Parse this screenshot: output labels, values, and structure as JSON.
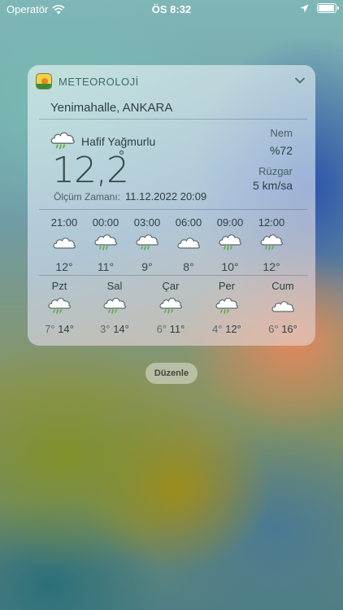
{
  "status_bar": {
    "carrier": "Operatör",
    "time": "ÖS 8:32"
  },
  "widget": {
    "app_name": "METEOROLOJİ",
    "location": "Yenimahalle, ANKARA",
    "current": {
      "condition": "Hafif Yağmurlu",
      "temperature": "12,2",
      "degree_symbol": "°",
      "measure_label": "Ölçüm Zamanı:",
      "measure_time": "11.12.2022 20:09",
      "humidity_label": "Nem",
      "humidity_value": "%72",
      "wind_label": "Rüzgar",
      "wind_value": "5 km/sa"
    },
    "hourly": [
      {
        "time": "21:00",
        "icon": "cloud-icon",
        "temp": "12°"
      },
      {
        "time": "00:00",
        "icon": "rain-cloud-icon",
        "temp": "11°"
      },
      {
        "time": "03:00",
        "icon": "rain-cloud-icon",
        "temp": "9°"
      },
      {
        "time": "06:00",
        "icon": "cloud-icon",
        "temp": "8°"
      },
      {
        "time": "09:00",
        "icon": "rain-cloud-icon",
        "temp": "10°"
      },
      {
        "time": "12:00",
        "icon": "rain-cloud-icon",
        "temp": "12°"
      }
    ],
    "daily": [
      {
        "day": "Pzt",
        "icon": "rain-cloud-icon",
        "low": "7°",
        "high": "14°"
      },
      {
        "day": "Sal",
        "icon": "rain-cloud-icon",
        "low": "3°",
        "high": "14°"
      },
      {
        "day": "Çar",
        "icon": "rain-cloud-icon",
        "low": "6°",
        "high": "11°"
      },
      {
        "day": "Per",
        "icon": "rain-cloud-icon",
        "low": "4°",
        "high": "12°"
      },
      {
        "day": "Cum",
        "icon": "cloud-icon",
        "low": "6°",
        "high": "16°"
      }
    ]
  },
  "edit_button": "Düzenle",
  "colors": {
    "rain_drop": "#5fae3a",
    "cloud_fill": "#ffffff",
    "cloud_stroke": "#5c6b6f"
  }
}
